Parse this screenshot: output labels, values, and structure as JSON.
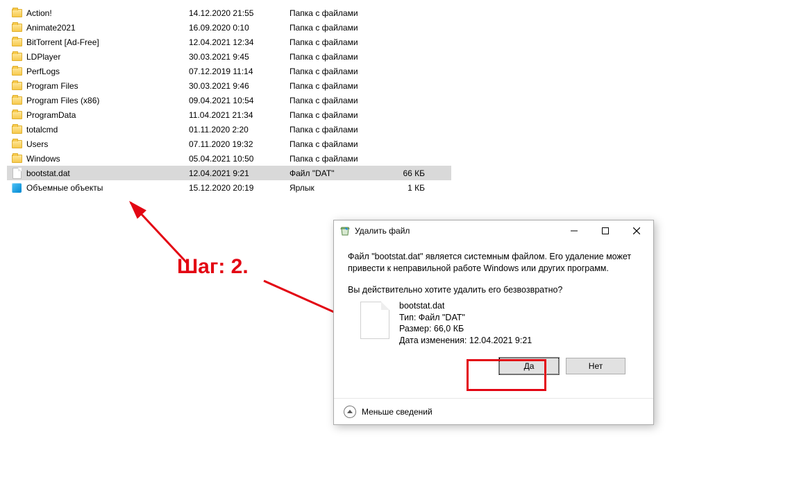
{
  "files": [
    {
      "name": "Action!",
      "date": "14.12.2020 21:55",
      "type": "Папка с файлами",
      "size": "",
      "icon": "folder"
    },
    {
      "name": "Animate2021",
      "date": "16.09.2020 0:10",
      "type": "Папка с файлами",
      "size": "",
      "icon": "folder"
    },
    {
      "name": "BitTorrent [Ad-Free]",
      "date": "12.04.2021 12:34",
      "type": "Папка с файлами",
      "size": "",
      "icon": "folder"
    },
    {
      "name": "LDPlayer",
      "date": "30.03.2021 9:45",
      "type": "Папка с файлами",
      "size": "",
      "icon": "folder"
    },
    {
      "name": "PerfLogs",
      "date": "07.12.2019 11:14",
      "type": "Папка с файлами",
      "size": "",
      "icon": "folder"
    },
    {
      "name": "Program Files",
      "date": "30.03.2021 9:46",
      "type": "Папка с файлами",
      "size": "",
      "icon": "folder"
    },
    {
      "name": "Program Files (x86)",
      "date": "09.04.2021 10:54",
      "type": "Папка с файлами",
      "size": "",
      "icon": "folder"
    },
    {
      "name": "ProgramData",
      "date": "11.04.2021 21:34",
      "type": "Папка с файлами",
      "size": "",
      "icon": "folder"
    },
    {
      "name": "totalcmd",
      "date": "01.11.2020 2:20",
      "type": "Папка с файлами",
      "size": "",
      "icon": "folder"
    },
    {
      "name": "Users",
      "date": "07.11.2020 19:32",
      "type": "Папка с файлами",
      "size": "",
      "icon": "folder"
    },
    {
      "name": "Windows",
      "date": "05.04.2021 10:50",
      "type": "Папка с файлами",
      "size": "",
      "icon": "folder"
    },
    {
      "name": "bootstat.dat",
      "date": "12.04.2021 9:21",
      "type": "Файл \"DAT\"",
      "size": "66 КБ",
      "icon": "file",
      "selected": true
    },
    {
      "name": "Объемные объекты",
      "date": "15.12.2020 20:19",
      "type": "Ярлык",
      "size": "1 КБ",
      "icon": "cube"
    }
  ],
  "annot": {
    "step": "Шаг: 2."
  },
  "dialog": {
    "title": "Удалить файл",
    "warn": "Файл \"bootstat.dat\" является системным файлом. Его удаление может привести к неправильной работе Windows или других программ.",
    "confirm": "Вы действительно хотите удалить его безвозвратно?",
    "filename": "bootstat.dat",
    "typeline": "Тип: Файл \"DAT\"",
    "sizeline": "Размер: 66,0 КБ",
    "dateline": "Дата изменения: 12.04.2021 9:21",
    "yes": "Да",
    "no": "Нет",
    "less": "Меньше сведений"
  }
}
